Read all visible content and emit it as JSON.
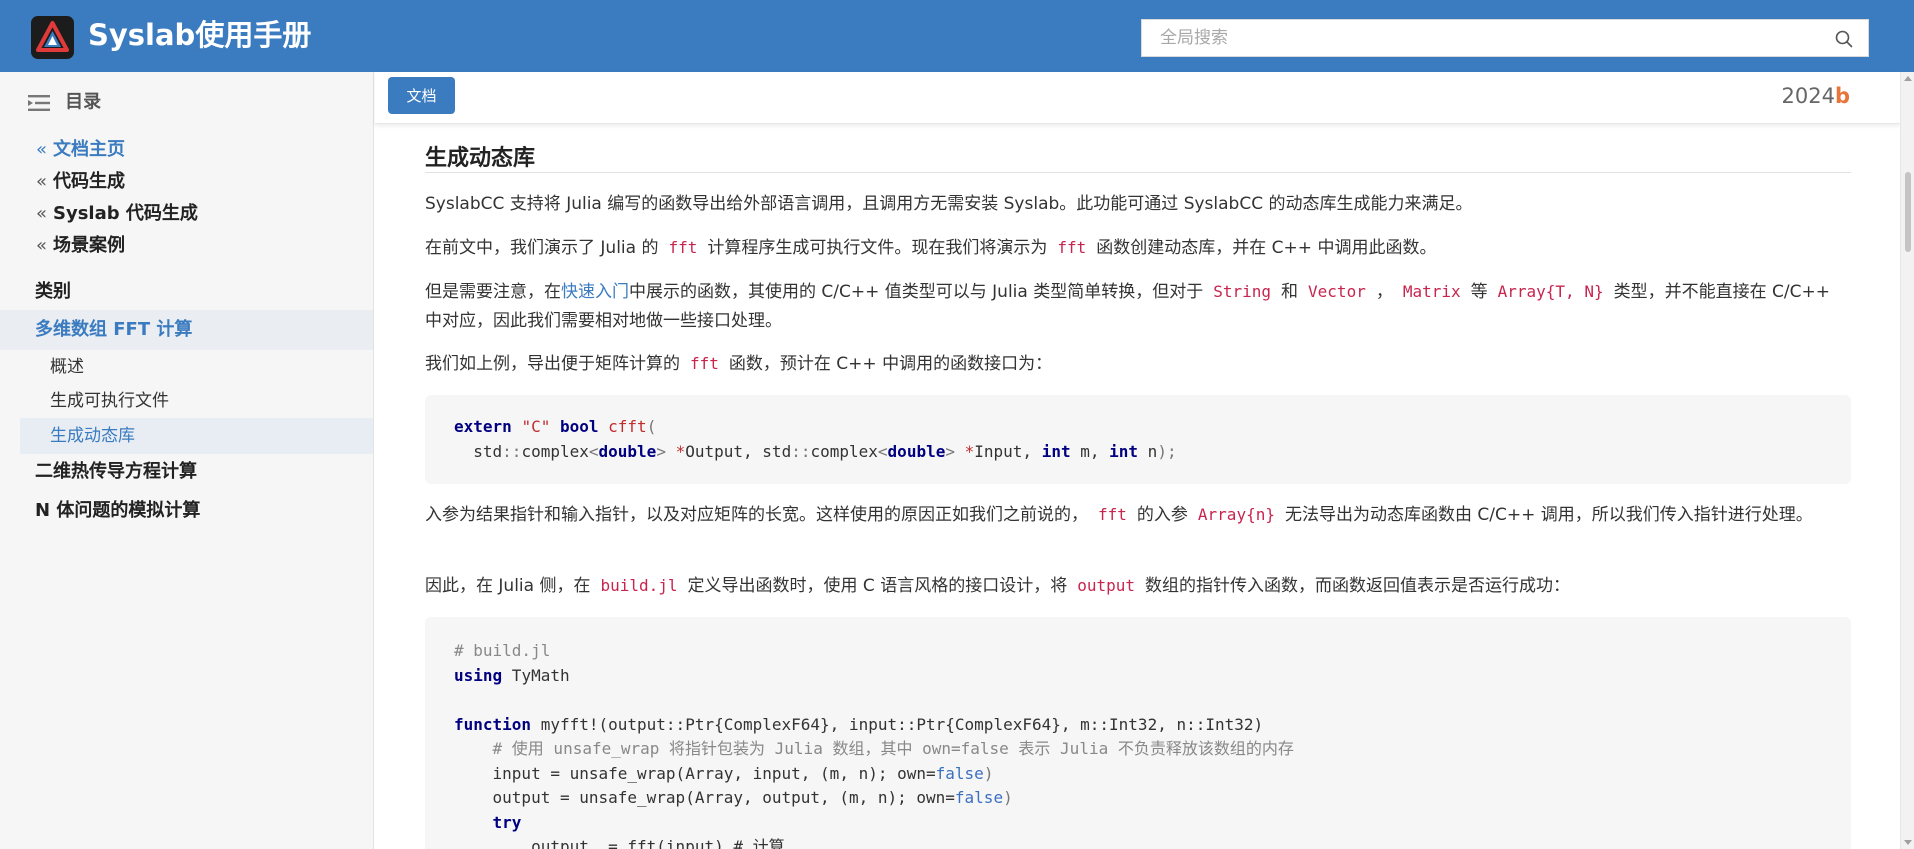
{
  "header": {
    "app_title": "Syslab使用手册",
    "search_placeholder": "全局搜索"
  },
  "sidebar": {
    "toc_title": "目录",
    "breadcrumbs": [
      {
        "label": "文档主页"
      },
      {
        "label": "代码生成"
      },
      {
        "label": "Syslab 代码生成"
      },
      {
        "label": "场景案例"
      }
    ],
    "items": [
      {
        "label": "类别"
      },
      {
        "label": "多维数组 FFT 计算",
        "active": true
      },
      {
        "label": "二维热传导方程计算"
      },
      {
        "label": "N 体问题的模拟计算"
      }
    ],
    "subitems": [
      {
        "label": "概述"
      },
      {
        "label": "生成可执行文件"
      },
      {
        "label": "生成动态库",
        "active": true
      }
    ]
  },
  "docbar": {
    "doc_button": "文档",
    "version_prefix": "2024",
    "version_suffix": "b"
  },
  "content": {
    "heading": "生成动态库",
    "p1": "SyslabCC 支持将 Julia 编写的函数导出给外部语言调用，且调用方无需安装 Syslab。此功能可通过 SyslabCC 的动态库生成能力来满足。",
    "p2_a": "在前文中，我们演示了 Julia 的",
    "p2_code1": "fft",
    "p2_b": "计算程序生成可执行文件。现在我们将演示为",
    "p2_code2": "fft",
    "p2_c": "函数创建动态库，并在 C++ 中调用此函数。",
    "p3_a": "但是需要注意，在",
    "p3_link": "快速入门",
    "p3_b": "中展示的函数，其使用的 C/C++ 值类型可以与 Julia 类型简单转换，但对于",
    "p3_code1": "String",
    "p3_c": "和",
    "p3_code2": "Vector",
    "p3_d": "，",
    "p3_code3": "Matrix",
    "p3_e": "等",
    "p3_code4": "Array{T, N}",
    "p3_f": "类型，并不能直接在 C/C++ 中对应，因此我们需要相对地做一些接口处理。",
    "p4_a": "我们如上例，导出便于矩阵计算的",
    "p4_code": "fft",
    "p4_b": "函数，预计在 C++ 中调用的函数接口为：",
    "p5_a": "入参为结果指针和输入指针，以及对应矩阵的长宽。这样使用的原因正如我们之前说的，",
    "p5_code1": "fft",
    "p5_b": "的入参",
    "p5_code2": "Array{n}",
    "p5_c": "无法导出为动态库函数由 C/C++ 调用，所以我们传入指针进行处理。",
    "p6_a": "因此，在 Julia 侧，在",
    "p6_code1": "build.jl",
    "p6_b": "定义导出函数时，使用 C 语言风格的接口设计，将",
    "p6_code2": "output",
    "p6_c": "数组的指针传入函数，而函数返回值表示是否运行成功：",
    "code1": {
      "t_extern": "extern",
      "t_c": "\"C\"",
      "t_bool": "bool",
      "t_cfft": "cfft",
      "t_paren": "(",
      "t_std1": "std",
      "t_sep1": "::",
      "t_complex1": "complex",
      "t_lt1": "<",
      "t_double1": "double",
      "t_gt1": ">",
      "t_star1": "*",
      "t_output": "Output, ",
      "t_std2": "std",
      "t_sep2": "::",
      "t_complex2": "complex",
      "t_lt2": "<",
      "t_double2": "double",
      "t_gt2": ">",
      "t_star2": "*",
      "t_input": "Input, ",
      "t_int1": "int",
      "t_m": " m, ",
      "t_int2": "int",
      "t_n": " n",
      "t_end": ");"
    },
    "code2": {
      "comment1": "# build.jl",
      "using_kw": "using",
      "using_rest": " TyMath",
      "function_kw": "function",
      "func_sig": " myfft!(output::Ptr{ComplexF64}, input::Ptr{ComplexF64}, m::Int32, n::Int32)",
      "comment2": "    # 使用 unsafe_wrap 将指针包装为 Julia 数组，其中 own=false 表示 Julia 不负责释放该数组的内存",
      "line_input": "    input = unsafe_wrap(Array, input, (m, n); own=",
      "line_output": "    output = unsafe_wrap(Array, output, (m, n); own=",
      "false_kw": "false",
      "close_paren": ")",
      "try_kw": "try",
      "line_partial": "        output .= fft(input) # 计算"
    }
  }
}
